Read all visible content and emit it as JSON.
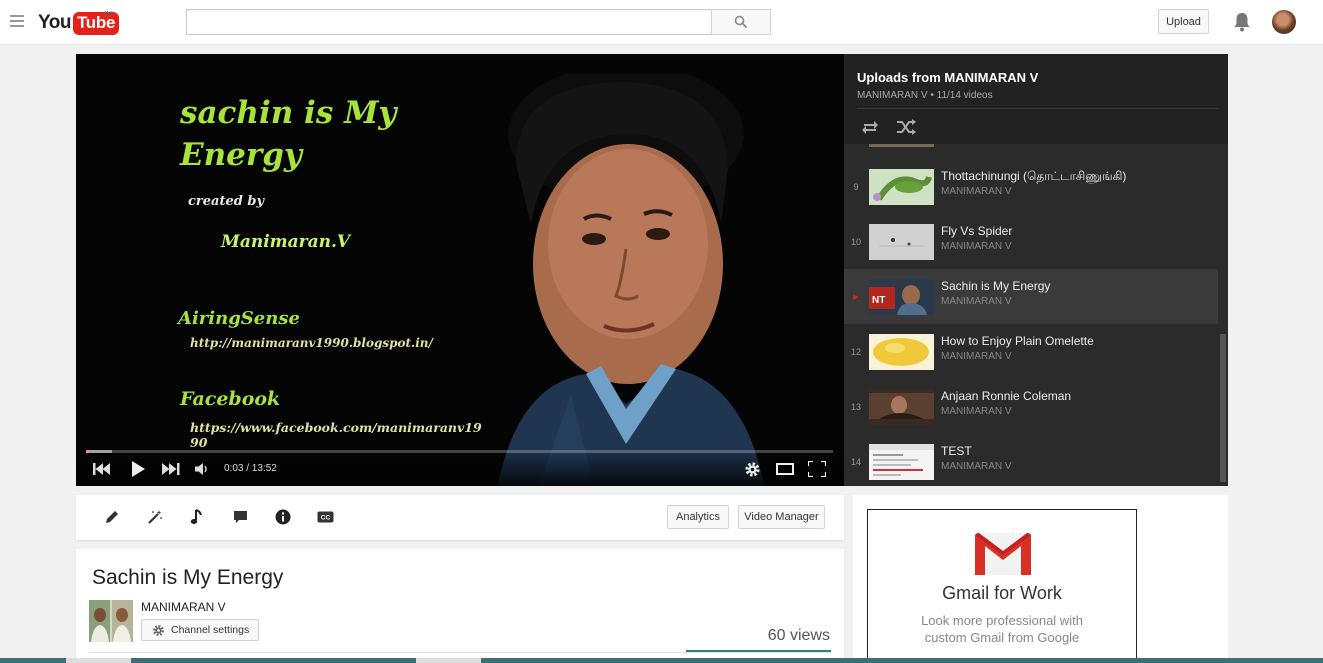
{
  "header": {
    "logo_you": "You",
    "logo_tube": "Tube",
    "region": "IN",
    "search_value": "",
    "upload_label": "Upload"
  },
  "player": {
    "title_line": "sachin is My Energy",
    "created_by": "created by",
    "author": "Manimaran.V",
    "brand": "AiringSense",
    "blog_url": "http://manimaranv1990.blogspot.in/",
    "facebook_label": "Facebook",
    "facebook_url": "https://www.facebook.com/manimaranv1990",
    "time": "0:03 / 13:52",
    "progress": 0.004,
    "buffered": 0.035
  },
  "playlist": {
    "title": "Uploads from MANIMARAN V",
    "subtitle": "MANIMARAN V • 11/14 videos",
    "items": [
      {
        "index": "9",
        "name": "Thottachinungi (தொட்டாசிணுங்கி)",
        "owner": "MANIMARAN V",
        "active": false
      },
      {
        "index": "10",
        "name": "Fly Vs Spider",
        "owner": "MANIMARAN V",
        "active": false
      },
      {
        "index": "▶",
        "name": "Sachin is My Energy",
        "owner": "MANIMARAN V",
        "active": true
      },
      {
        "index": "12",
        "name": "How to Enjoy Plain Omelette",
        "owner": "MANIMARAN V",
        "active": false
      },
      {
        "index": "13",
        "name": "Anjaan Ronnie Coleman",
        "owner": "MANIMARAN V",
        "active": false
      },
      {
        "index": "14",
        "name": "TEST",
        "owner": "MANIMARAN V",
        "active": false
      }
    ]
  },
  "actions": {
    "analytics_label": "Analytics",
    "video_manager_label": "Video Manager",
    "cc_label": "CC"
  },
  "video": {
    "title": "Sachin is My Energy",
    "owner": "MANIMARAN V",
    "channel_settings_label": "Channel settings",
    "views": "60 views"
  },
  "ad": {
    "title": "Gmail for Work",
    "text": "Look more professional with custom Gmail from Google"
  },
  "colors": {
    "brand_red": "#e62117",
    "title_green": "#a6e43a",
    "views_bar": "#2a7f7f"
  }
}
